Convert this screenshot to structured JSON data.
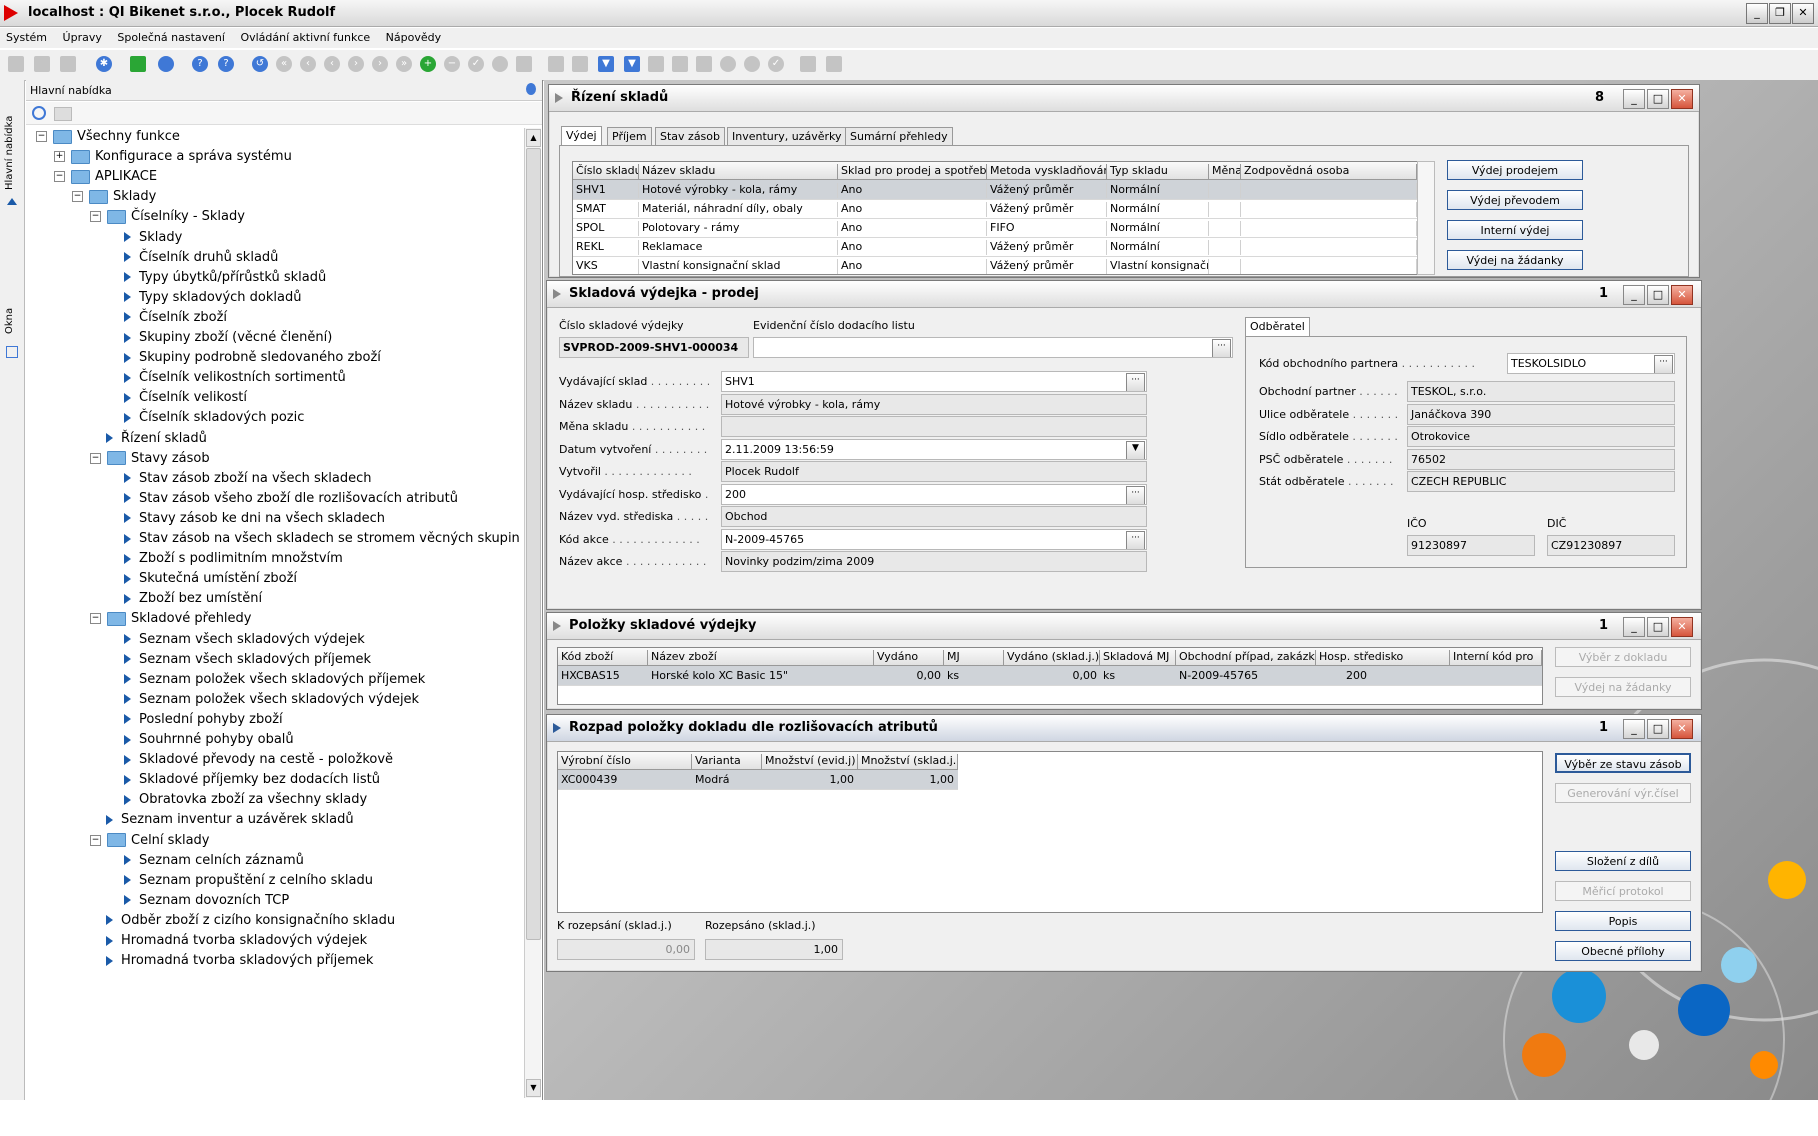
{
  "window": {
    "title": "localhost : QI  Bikenet s.r.o., Plocek Rudolf"
  },
  "menu": [
    "Systém",
    "Úpravy",
    "Společná nastavení",
    "Ovládání aktivní funkce",
    "Nápovědy"
  ],
  "left": {
    "vtab1": "Hlavní nabídka",
    "vtab2": "Okna",
    "header": "Hlavní nabídka",
    "tree": [
      {
        "label": "Všechny funkce",
        "lvl": 0,
        "type": "folder",
        "pm": "−"
      },
      {
        "label": "Konfigurace a správa systému",
        "lvl": 1,
        "type": "folder",
        "pm": "+"
      },
      {
        "label": "APLIKACE",
        "lvl": 1,
        "type": "folder",
        "pm": "−"
      },
      {
        "label": "Sklady",
        "lvl": 2,
        "type": "folder",
        "pm": "−"
      },
      {
        "label": "Číselníky - Sklady",
        "lvl": 3,
        "type": "folder",
        "pm": "−"
      },
      {
        "label": "Sklady",
        "lvl": 4,
        "type": "leaf"
      },
      {
        "label": "Číselník druhů skladů",
        "lvl": 4,
        "type": "leaf"
      },
      {
        "label": "Typy úbytků/přírůstků skladů",
        "lvl": 4,
        "type": "leaf"
      },
      {
        "label": "Typy skladových dokladů",
        "lvl": 4,
        "type": "leaf"
      },
      {
        "label": "Číselník zboží",
        "lvl": 4,
        "type": "leaf"
      },
      {
        "label": "Skupiny zboží (věcné členění)",
        "lvl": 4,
        "type": "leaf"
      },
      {
        "label": "Skupiny podrobně sledovaného zboží",
        "lvl": 4,
        "type": "leaf"
      },
      {
        "label": "Číselník velikostních sortimentů",
        "lvl": 4,
        "type": "leaf"
      },
      {
        "label": "Číselník velikostí",
        "lvl": 4,
        "type": "leaf"
      },
      {
        "label": "Číselník skladových pozic",
        "lvl": 4,
        "type": "leaf"
      },
      {
        "label": "Řízení skladů",
        "lvl": 3,
        "type": "leaf"
      },
      {
        "label": "Stavy zásob",
        "lvl": 3,
        "type": "folder",
        "pm": "−"
      },
      {
        "label": "Stav zásob zboží na všech skladech",
        "lvl": 4,
        "type": "leaf"
      },
      {
        "label": "Stav zásob všeho zboží dle rozlišovacích atributů",
        "lvl": 4,
        "type": "leaf"
      },
      {
        "label": "Stavy zásob ke dni na všech skladech",
        "lvl": 4,
        "type": "leaf"
      },
      {
        "label": "Stav zásob na všech skladech se stromem věcných skupin",
        "lvl": 4,
        "type": "leaf"
      },
      {
        "label": "Zboží s podlimitním množstvím",
        "lvl": 4,
        "type": "leaf"
      },
      {
        "label": "Skutečná umístění zboží",
        "lvl": 4,
        "type": "leaf"
      },
      {
        "label": "Zboží bez umístění",
        "lvl": 4,
        "type": "leaf"
      },
      {
        "label": "Skladové přehledy",
        "lvl": 3,
        "type": "folder",
        "pm": "−"
      },
      {
        "label": "Seznam všech skladových výdejek",
        "lvl": 4,
        "type": "leaf"
      },
      {
        "label": "Seznam všech skladových příjemek",
        "lvl": 4,
        "type": "leaf"
      },
      {
        "label": "Seznam položek všech skladových příjemek",
        "lvl": 4,
        "type": "leaf"
      },
      {
        "label": "Seznam položek všech skladových výdejek",
        "lvl": 4,
        "type": "leaf"
      },
      {
        "label": "Poslední pohyby zboží",
        "lvl": 4,
        "type": "leaf"
      },
      {
        "label": "Souhrnné pohyby obalů",
        "lvl": 4,
        "type": "leaf"
      },
      {
        "label": "Skladové převody na cestě - položkově",
        "lvl": 4,
        "type": "leaf"
      },
      {
        "label": "Skladové příjemky bez dodacích listů",
        "lvl": 4,
        "type": "leaf"
      },
      {
        "label": "Obratovka zboží za všechny sklady",
        "lvl": 4,
        "type": "leaf"
      },
      {
        "label": "Seznam inventur a uzávěrek skladů",
        "lvl": 3,
        "type": "leaf"
      },
      {
        "label": "Celní sklady",
        "lvl": 3,
        "type": "folder",
        "pm": "−"
      },
      {
        "label": "Seznam celních záznamů",
        "lvl": 4,
        "type": "leaf"
      },
      {
        "label": "Seznam propuštění z celního skladu",
        "lvl": 4,
        "type": "leaf"
      },
      {
        "label": "Seznam dovozních TCP",
        "lvl": 4,
        "type": "leaf"
      },
      {
        "label": "Odběr zboží z cizího konsignačního skladu",
        "lvl": 3,
        "type": "leaf"
      },
      {
        "label": "Hromadná tvorba skladových výdejek",
        "lvl": 3,
        "type": "leaf"
      },
      {
        "label": "Hromadná tvorba skladových příjemek",
        "lvl": 3,
        "type": "leaf"
      }
    ]
  },
  "w1": {
    "title": "Řízení skladů",
    "num": "8",
    "tabs": [
      "Výdej",
      "Příjem",
      "Stav zásob",
      "Inventury, uzávěrky",
      "Sumární přehledy"
    ],
    "cols": [
      "Číslo skladu",
      "Název skladu",
      "Sklad pro prodej a spotřebu",
      "Metoda vyskladňování",
      "Typ skladu",
      "Měna",
      "Zodpovědná osoba"
    ],
    "rows": [
      [
        "SHV1",
        "Hotové výrobky - kola, rámy",
        "Ano",
        "Vážený průměr",
        "Normální",
        "",
        ""
      ],
      [
        "SMAT",
        "Materiál, náhradní díly, obaly",
        "Ano",
        "Vážený průměr",
        "Normální",
        "",
        ""
      ],
      [
        "SPOL",
        "Polotovary - rámy",
        "Ano",
        "FIFO",
        "Normální",
        "",
        ""
      ],
      [
        "REKL",
        "Reklamace",
        "Ano",
        "Vážený průměr",
        "Normální",
        "",
        ""
      ],
      [
        "VKS",
        "Vlastní konsignační sklad",
        "Ano",
        "Vážený průměr",
        "Vlastní konsignační",
        "",
        ""
      ]
    ],
    "buttons": [
      "Výdej prodejem",
      "Výdej převodem",
      "Interní výdej",
      "Výdej na žádanky"
    ]
  },
  "w2": {
    "title": "Skladová výdejka - prodej",
    "num": "1",
    "lbl_cislo": "Číslo skladové výdejky",
    "val_cislo": "SVPROD-2009-SHV1-000034",
    "lbl_evid": "Evidenční číslo dodacího listu",
    "val_evid": "",
    "fields": [
      {
        "label": "Vydávající sklad",
        "value": "SHV1"
      },
      {
        "label": "Název skladu",
        "value": "Hotové výrobky - kola, rámy"
      },
      {
        "label": "Měna skladu",
        "value": ""
      },
      {
        "label": "Datum vytvoření",
        "value": "2.11.2009 13:56:59"
      },
      {
        "label": "Vytvořil",
        "value": "Plocek Rudolf"
      },
      {
        "label": "Vydávající hosp. středisko",
        "value": "200"
      },
      {
        "label": "Název vyd. střediska",
        "value": "Obchod"
      },
      {
        "label": "Kód akce",
        "value": "N-2009-45765"
      },
      {
        "label": "Název akce",
        "value": "Novinky podzim/zima 2009"
      }
    ],
    "odb_tab": "Odběratel",
    "odb": [
      {
        "label": "Kód obchodního partnera",
        "value": "TESKOLSIDLO"
      },
      {
        "label": "Obchodní partner",
        "value": "TESKOL, s.r.o."
      },
      {
        "label": "Ulice odběratele",
        "value": "Janáčkova 390"
      },
      {
        "label": "Sídlo odběratele",
        "value": "Otrokovice"
      },
      {
        "label": "PSČ odběratele",
        "value": "76502"
      },
      {
        "label": "Stát odběratele",
        "value": "CZECH REPUBLIC"
      }
    ],
    "lbl_ico": "IČO",
    "val_ico": "91230897",
    "lbl_dic": "DIČ",
    "val_dic": "CZ91230897"
  },
  "w3": {
    "title": "Položky skladové výdejky",
    "num": "1",
    "cols": [
      "Kód zboží",
      "Název zboží",
      "Vydáno",
      "MJ",
      "Vydáno (sklad.j.)",
      "Skladová MJ",
      "Obchodní případ, zakázka",
      "Hosp. středisko",
      "Interní kód pro"
    ],
    "row": [
      "HXCBAS15",
      "Horské kolo XC Basic 15\"",
      "0,00",
      "ks",
      "0,00",
      "ks",
      "N-2009-45765",
      "200",
      ""
    ],
    "buttons": [
      "Výběr z dokladu",
      "Výdej na žádanky"
    ]
  },
  "w4": {
    "title": "Rozpad položky dokladu dle rozlišovacích atributů",
    "num": "1",
    "cols": [
      "Výrobní číslo",
      "Varianta",
      "Množství (evid.j)",
      "Množství (sklad.j.)"
    ],
    "row": [
      "XC000439",
      "Modrá",
      "1,00",
      "1,00"
    ],
    "lbl_k": "K rozepsání (sklad.j.)",
    "val_k": "0,00",
    "lbl_r": "Rozepsáno (sklad.j.)",
    "val_r": "1,00",
    "buttons": [
      "Výběr ze stavu zásob",
      "Generování výr.čísel",
      "Složení z dílů",
      "Měřicí protokol",
      "Popis",
      "Obecné přílohy"
    ]
  }
}
